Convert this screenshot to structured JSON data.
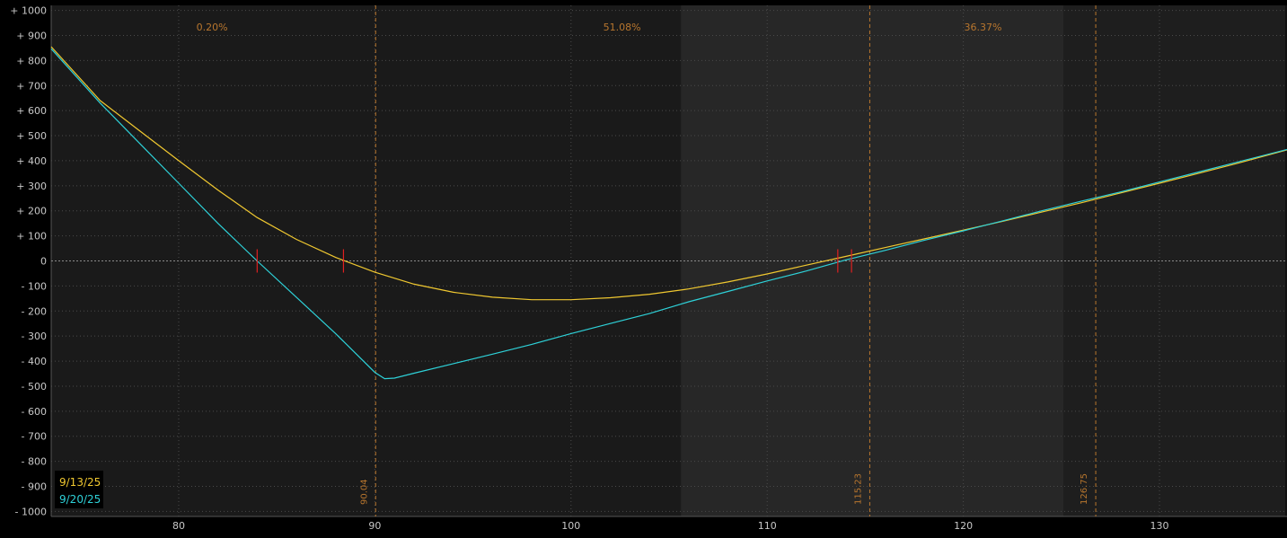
{
  "chart_data": {
    "type": "line",
    "title": "",
    "xlabel": "",
    "ylabel": "",
    "xlim": [
      73.5,
      136.5
    ],
    "ylim": [
      -1020,
      1020
    ],
    "x_ticks": [
      {
        "value": 80,
        "label": "80"
      },
      {
        "value": 90,
        "label": "90"
      },
      {
        "value": 100,
        "label": "100"
      },
      {
        "value": 110,
        "label": "110"
      },
      {
        "value": 120,
        "label": "120"
      },
      {
        "value": 130,
        "label": "130"
      }
    ],
    "y_ticks": [
      {
        "value": 1000,
        "label": "+ 1000"
      },
      {
        "value": 900,
        "label": "+ 900"
      },
      {
        "value": 800,
        "label": "+ 800"
      },
      {
        "value": 700,
        "label": "+ 700"
      },
      {
        "value": 600,
        "label": "+ 600"
      },
      {
        "value": 500,
        "label": "+ 500"
      },
      {
        "value": 400,
        "label": "+ 400"
      },
      {
        "value": 300,
        "label": "+ 300"
      },
      {
        "value": 200,
        "label": "+ 200"
      },
      {
        "value": 100,
        "label": "+ 100"
      },
      {
        "value": 0,
        "label": "0"
      },
      {
        "value": -100,
        "label": "- 100"
      },
      {
        "value": -200,
        "label": "- 200"
      },
      {
        "value": -300,
        "label": "- 300"
      },
      {
        "value": -400,
        "label": "- 400"
      },
      {
        "value": -500,
        "label": "- 500"
      },
      {
        "value": -600,
        "label": "- 600"
      },
      {
        "value": -700,
        "label": "- 700"
      },
      {
        "value": -800,
        "label": "- 800"
      },
      {
        "value": -900,
        "label": "- 900"
      },
      {
        "value": -1000,
        "label": "- 1000"
      }
    ],
    "regions": [
      {
        "x_start": 73.5,
        "x_end": 105.6,
        "probability": "0.20%",
        "label_x": 81.7
      },
      {
        "x_start": 105.6,
        "x_end": 125.1,
        "probability": "51.08%",
        "label_x": 102.6
      },
      {
        "x_start": 125.1,
        "x_end": 136.5,
        "probability": "36.37%",
        "label_x": 121.0
      }
    ],
    "vertical_lines": [
      {
        "x": 90.04,
        "label": "90.04"
      },
      {
        "x": 115.23,
        "label": "115.23"
      },
      {
        "x": 126.75,
        "label": "126.75"
      }
    ],
    "breakeven_marks": [
      84.0,
      88.4,
      113.6,
      114.3
    ],
    "series": [
      {
        "name": "9/13/25",
        "color": "#f0c830",
        "points": [
          [
            73.5,
            855
          ],
          [
            76,
            640
          ],
          [
            78,
            520
          ],
          [
            80,
            400
          ],
          [
            82,
            283
          ],
          [
            84,
            173
          ],
          [
            86,
            86
          ],
          [
            88,
            14
          ],
          [
            90,
            -45
          ],
          [
            92,
            -93
          ],
          [
            94,
            -125
          ],
          [
            96,
            -145
          ],
          [
            98,
            -155
          ],
          [
            100,
            -155
          ],
          [
            102,
            -147
          ],
          [
            104,
            -133
          ],
          [
            106,
            -112
          ],
          [
            108,
            -84
          ],
          [
            110,
            -52
          ],
          [
            112,
            -17
          ],
          [
            114,
            18
          ],
          [
            116,
            53
          ],
          [
            118,
            88
          ],
          [
            120,
            123
          ],
          [
            122,
            158
          ],
          [
            124,
            195
          ],
          [
            126,
            232
          ],
          [
            128,
            271
          ],
          [
            130,
            310
          ],
          [
            132,
            350
          ],
          [
            134,
            390
          ],
          [
            136.5,
            443
          ]
        ]
      },
      {
        "name": "9/20/25",
        "color": "#2ed1d8",
        "points": [
          [
            73.5,
            847
          ],
          [
            76,
            630
          ],
          [
            78,
            470
          ],
          [
            80,
            310
          ],
          [
            82,
            150
          ],
          [
            84,
            0
          ],
          [
            86,
            -145
          ],
          [
            88,
            -290
          ],
          [
            90,
            -445
          ],
          [
            90.5,
            -470
          ],
          [
            91,
            -468
          ],
          [
            92,
            -448
          ],
          [
            94,
            -410
          ],
          [
            96,
            -372
          ],
          [
            98,
            -333
          ],
          [
            100,
            -290
          ],
          [
            102,
            -250
          ],
          [
            104,
            -210
          ],
          [
            106,
            -163
          ],
          [
            108,
            -122
          ],
          [
            110,
            -80
          ],
          [
            112,
            -40
          ],
          [
            114,
            4
          ],
          [
            116,
            42
          ],
          [
            118,
            82
          ],
          [
            120,
            120
          ],
          [
            122,
            160
          ],
          [
            124,
            200
          ],
          [
            126,
            238
          ],
          [
            128,
            275
          ],
          [
            130,
            315
          ],
          [
            132,
            355
          ],
          [
            134,
            395
          ],
          [
            136.5,
            445
          ]
        ]
      }
    ],
    "grid": true,
    "legend_position": "bottom-left"
  }
}
